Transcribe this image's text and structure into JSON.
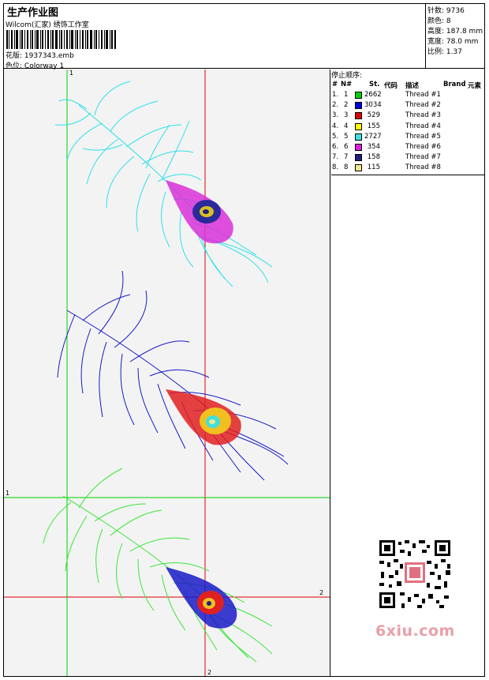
{
  "header": {
    "title": "生产作业图",
    "company": "Wilcom(汇家) 绣饰工作室",
    "pattern_label": "花版:",
    "pattern_value": "1937343.emb",
    "colorway_label": "色位:",
    "colorway_value": "Colorway 1"
  },
  "stats": [
    {
      "label": "针数:",
      "value": "9736"
    },
    {
      "label": "颜色:",
      "value": "8"
    },
    {
      "label": "高度:",
      "value": "187.8 mm"
    },
    {
      "label": "宽度:",
      "value": "78.0 mm"
    },
    {
      "label": "比例:",
      "value": "1.37"
    }
  ],
  "stop_sequence": {
    "title": "停止顺序:",
    "columns": [
      "#",
      "N#",
      "St.",
      "代码",
      "描述",
      "Brand",
      "元素"
    ],
    "rows": [
      {
        "num": "1.",
        "n": "1",
        "color": "#00d000",
        "st": "2662",
        "desc": "Thread #1"
      },
      {
        "num": "2.",
        "n": "2",
        "color": "#0000e0",
        "st": "3034",
        "desc": "Thread #2"
      },
      {
        "num": "3.",
        "n": "3",
        "color": "#e00000",
        "st": "529",
        "desc": "Thread #3"
      },
      {
        "num": "4.",
        "n": "4",
        "color": "#ffff00",
        "st": "155",
        "desc": "Thread #4"
      },
      {
        "num": "5.",
        "n": "5",
        "color": "#40e0e0",
        "st": "2727",
        "desc": "Thread #5"
      },
      {
        "num": "6.",
        "n": "6",
        "color": "#e020e0",
        "st": "354",
        "desc": "Thread #6"
      },
      {
        "num": "7.",
        "n": "7",
        "color": "#202080",
        "st": "158",
        "desc": "Thread #7"
      },
      {
        "num": "8.",
        "n": "8",
        "color": "#f0e890",
        "st": "115",
        "desc": "Thread #8"
      }
    ]
  },
  "canvas": {
    "axis_labels": [
      "1",
      "1",
      "2",
      "2"
    ]
  },
  "watermark": "6xiu.com",
  "colors": {
    "cyan": "#2fe0ea",
    "blue": "#1a1ac8",
    "green": "#3be63b",
    "red": "#e02020",
    "magenta": "#d830d8"
  }
}
